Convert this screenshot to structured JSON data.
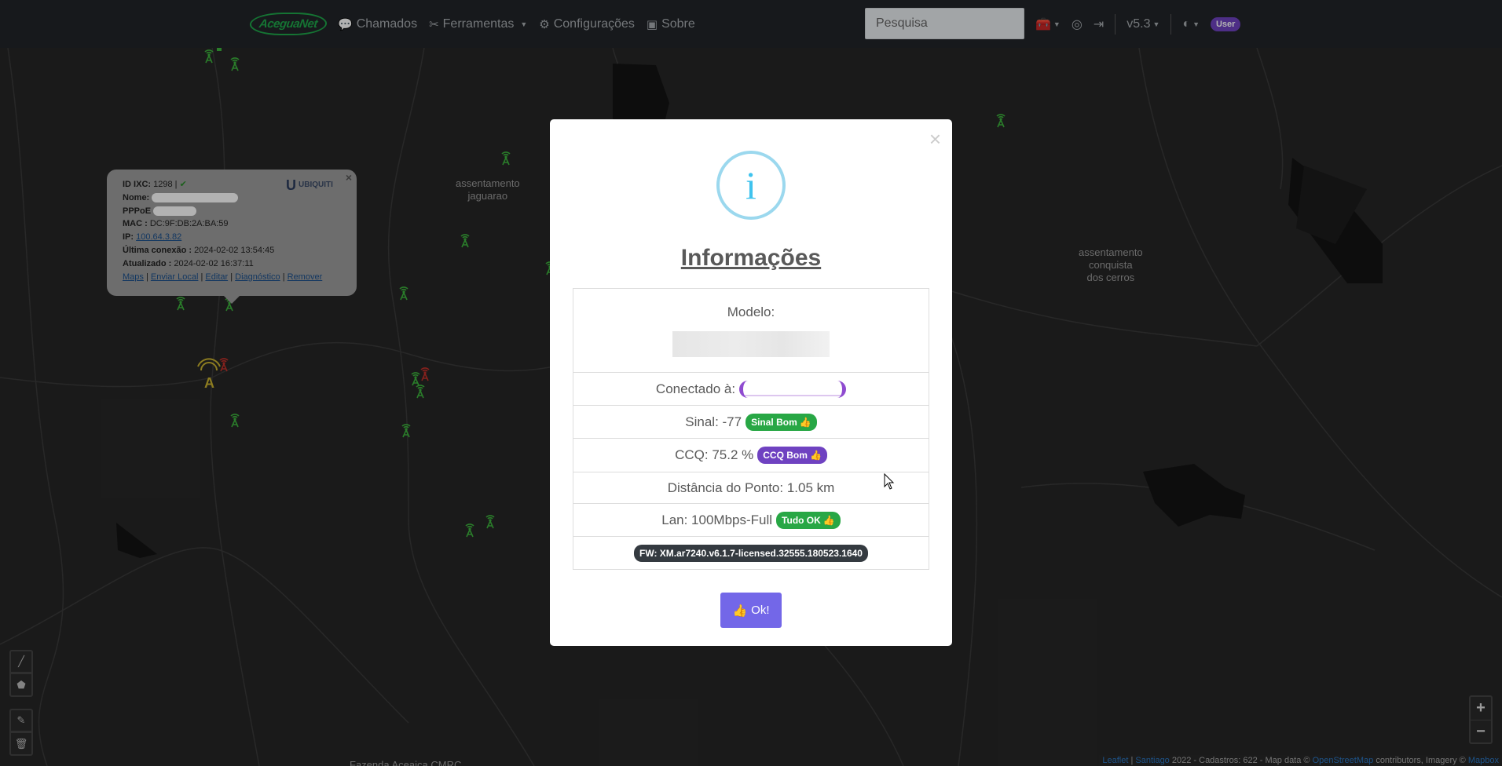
{
  "nav": {
    "brand": "AceguaNet",
    "items": [
      {
        "label": "Chamados",
        "icon": "comments-icon"
      },
      {
        "label": "Ferramentas",
        "icon": "tools-icon"
      },
      {
        "label": "Configurações",
        "icon": "gears-icon"
      },
      {
        "label": "Sobre",
        "icon": "id-card-icon"
      }
    ],
    "search_placeholder": "Pesquisa",
    "version": "v5.3",
    "user_badge": "User"
  },
  "map": {
    "places": [
      "assentamento\njaguarao",
      "assentamento\nconquista\ndos cerros",
      "Fazenda Aceaica CMRC"
    ],
    "attribution": {
      "leaflet": "Leaflet",
      "santiago": "Santiago",
      "text": "2022 - Cadastros: 622 - Map data ©",
      "osm": "OpenStreetMap",
      "text2": "contributors, Imagery ©",
      "mapbox": "Mapbox"
    }
  },
  "popup": {
    "id_label": "ID IXC:",
    "id_value": "1298 |",
    "nome_label": "Nome:",
    "pppoe_label": "PPPoE",
    "mac_label": "MAC :",
    "mac_value": "DC:9F:DB:2A:BA:59",
    "ip_label": "IP:",
    "ip_value": "100.64.3.82",
    "ultima_label": "Última conexão :",
    "ultima_value": "2024-02-02 13:54:45",
    "atualizado_label": "Atualizado :",
    "atualizado_value": "2024-02-02 16:37:11",
    "links": [
      "Maps",
      "Enviar Local",
      "Editar",
      "Diagnóstico",
      "Remover"
    ],
    "brand": "UBIQUITI",
    "close": "×"
  },
  "modal": {
    "title": "Informações",
    "icon_glyph": "i",
    "modelo_label": "Modelo:",
    "conectado_label": "Conectado à:",
    "sinal_text": "Sinal: -77",
    "sinal_badge": "Sinal Bom",
    "ccq_text": "CCQ: 75.2 %",
    "ccq_badge": "CCQ Bom",
    "distancia_text": "Distância do Ponto: 1.05 km",
    "lan_text": "Lan: 100Mbps-Full",
    "lan_badge": "Tudo OK",
    "fw_badge": "FW: XM.ar7240.v6.1.7-licensed.32555.180523.1640",
    "ok_label": "Ok!",
    "close": "×"
  },
  "colors": {
    "navbar": "#212529",
    "map_bg": "#262626",
    "tower_green": "#3db33d",
    "tower_red": "#c0302a",
    "modal_button": "#7367e8",
    "badge_green": "#28a745",
    "badge_purple": "#6f42c1",
    "info_icon": "#3fc3ee"
  }
}
